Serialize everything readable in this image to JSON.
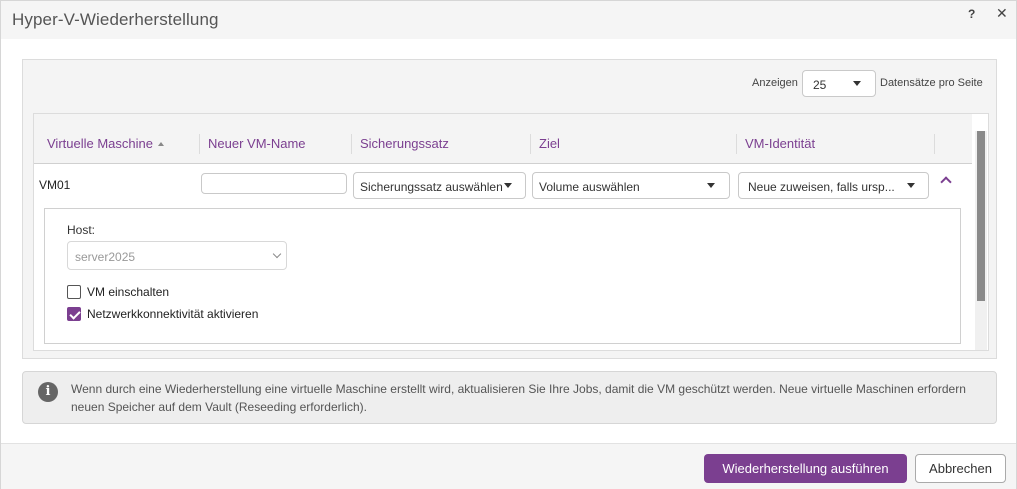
{
  "dialog": {
    "title": "Hyper-V-Wiederherstellung",
    "help_icon": "?",
    "close_icon": "✕"
  },
  "paging": {
    "prefix": "Anzeigen",
    "value": "25",
    "suffix": "Datensätze pro Seite"
  },
  "table": {
    "columns": [
      "Virtuelle Maschine",
      "Neuer VM-Name",
      "Sicherungssatz",
      "Ziel",
      "VM-Identität"
    ],
    "row": {
      "vm": "VM01",
      "new_name": "",
      "backup_set": "Sicherungssatz auswählen",
      "target": "Volume auswählen",
      "identity": "Neue zuweisen, falls ursp..."
    }
  },
  "detail": {
    "host_label": "Host:",
    "host_value": "server2025",
    "power_on_label": "VM einschalten",
    "power_on_checked": false,
    "network_label": "Netzwerkkonnektivität aktivieren",
    "network_checked": true
  },
  "info": {
    "icon": "i",
    "text": "Wenn durch eine Wiederherstellung eine virtuelle Maschine erstellt wird, aktualisieren Sie Ihre Jobs, damit die VM geschützt werden. Neue virtuelle Maschinen erfordern neuen Speicher auf dem Vault (Reseeding erforderlich)."
  },
  "footer": {
    "run_label": "Wiederherstellung ausführen",
    "cancel_label": "Abbrechen"
  },
  "colors": {
    "accent": "#7b3f90"
  }
}
